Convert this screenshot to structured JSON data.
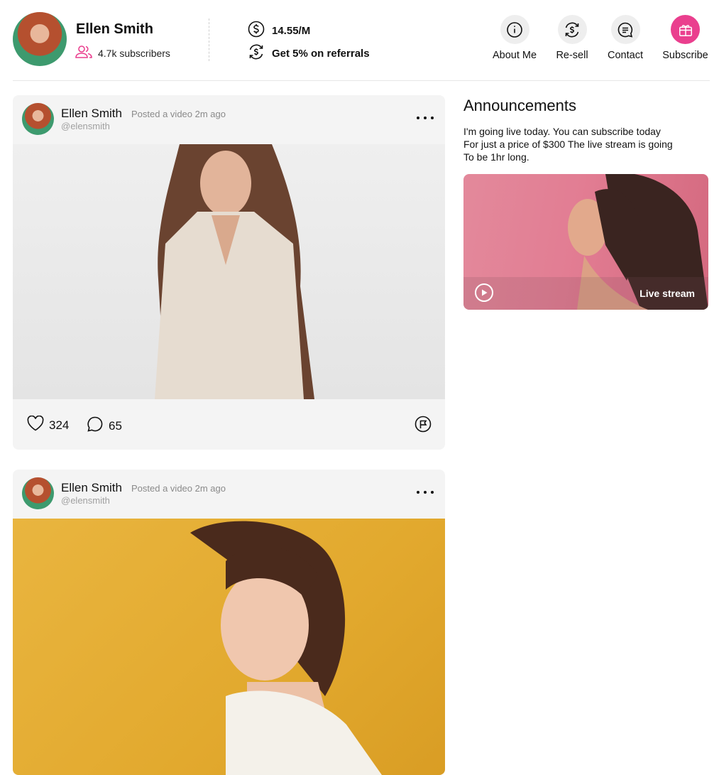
{
  "profile": {
    "name": "Ellen Smith",
    "subscribers": "4.7k subscribers",
    "price": "14.55/M",
    "referral": "Get 5% on referrals"
  },
  "nav": [
    {
      "label": "About Me",
      "icon": "info-icon"
    },
    {
      "label": "Re-sell",
      "icon": "resell-icon"
    },
    {
      "label": "Contact",
      "icon": "chat-icon"
    },
    {
      "label": "Subscribe",
      "icon": "gift-icon"
    }
  ],
  "posts": [
    {
      "name": "Ellen Smith",
      "meta": "Posted a video 2m ago",
      "handle": "@elensmith",
      "likes": "324",
      "comments": "65"
    },
    {
      "name": "Ellen Smith",
      "meta": "Posted a video 2m ago",
      "handle": "@elensmith"
    }
  ],
  "announcements": {
    "title": "Announcements",
    "lines": [
      "I'm going live today. You can subscribe today",
      "For just a price of $300  The live stream is going",
      "To be 1hr long."
    ],
    "live_label": "Live stream"
  },
  "colors": {
    "accent": "#ea3f8e"
  }
}
